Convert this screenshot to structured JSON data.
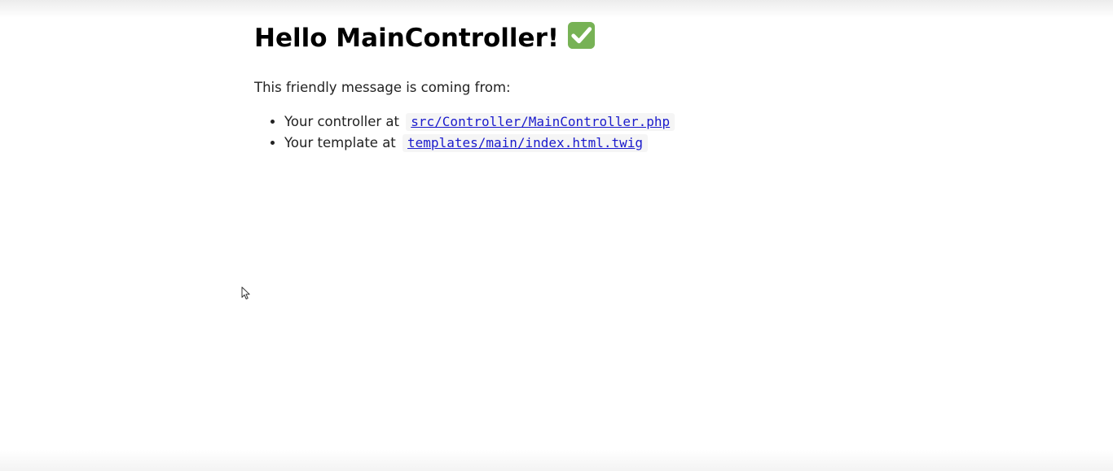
{
  "page": {
    "heading": "Hello MainController!",
    "heading_icon": "check-mark-icon",
    "intro": "This friendly message is coming from:",
    "items": [
      {
        "label": "Your controller at",
        "path": "src/Controller/MainController.php"
      },
      {
        "label": "Your template at",
        "path": "templates/main/index.html.twig"
      }
    ]
  },
  "colors": {
    "check_icon_background": "#77b255",
    "link": "#1a1acc",
    "code_background": "#f5f5f5"
  }
}
